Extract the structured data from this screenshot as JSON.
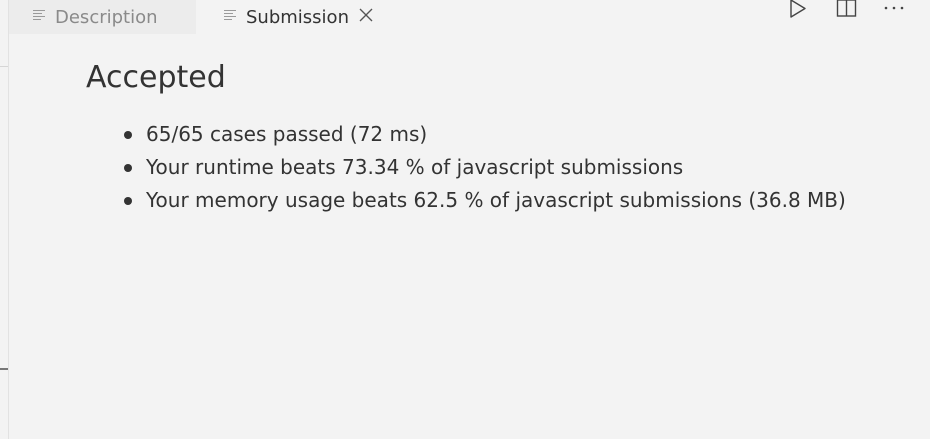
{
  "tabs": [
    {
      "label": "Description",
      "icon": "document-lines-icon",
      "active": false
    },
    {
      "label": "Submission",
      "icon": "document-lines-icon",
      "active": true,
      "closable": true
    }
  ],
  "toolbar": {
    "run_icon": "play-icon",
    "split_icon": "split-editor-icon",
    "more_icon": "more-actions-icon"
  },
  "result": {
    "status": "Accepted",
    "details": [
      "65/65 cases passed (72 ms)",
      "Your runtime beats 73.34 % of javascript submissions",
      "Your memory usage beats 62.5 % of javascript submissions (36.8 MB)"
    ]
  },
  "colors": {
    "background": "#f3f3f3",
    "inactive_tab": "#ececec",
    "text": "#333333",
    "muted_text": "#8a8a8a"
  }
}
